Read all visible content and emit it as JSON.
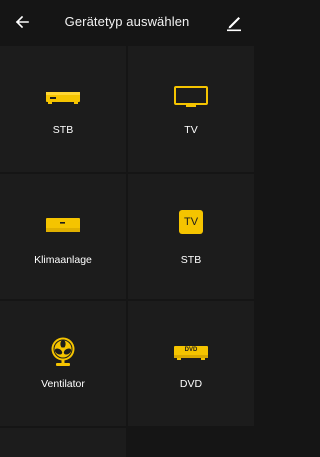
{
  "header": {
    "title": "Gerätetyp auswählen",
    "back_icon": "arrow-left-icon",
    "edit_icon": "pencil-icon"
  },
  "colors": {
    "accent": "#f5c400",
    "background": "#151515",
    "tile": "#1c1c1c",
    "text": "#ffffff"
  },
  "devices": [
    {
      "label": "STB",
      "icon": "set-top-box-icon"
    },
    {
      "label": "TV",
      "icon": "tv-icon"
    },
    {
      "label": "Klimaanlage",
      "icon": "air-conditioner-icon"
    },
    {
      "label": "STB",
      "icon": "tv-badge-icon",
      "icon_text": "TV"
    },
    {
      "label": "Ventilator",
      "icon": "fan-icon"
    },
    {
      "label": "DVD",
      "icon": "dvd-player-icon",
      "icon_text": "DVD"
    }
  ]
}
